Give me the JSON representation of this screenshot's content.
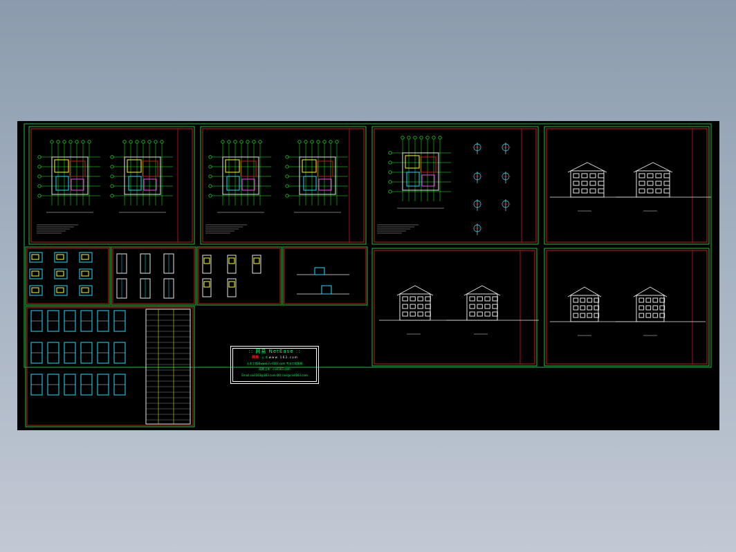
{
  "canvas": {
    "background": "#000000",
    "colors": {
      "frame_green": "#1fbf3f",
      "border_red": "#d01818",
      "line_white": "#e8e8e8",
      "axis_green": "#22ff22",
      "accent_cyan": "#20e0ff",
      "accent_yellow": "#ffff20",
      "accent_magenta": "#ff40ff"
    }
  },
  "stamp": {
    "line1": "::  网易  NetEase  ::",
    "brand": "网易",
    "brand_sub": "· 土 木",
    "brand_tail": "w w w . 1 6 3 . c o m",
    "line3": "土木工程网www.civil163.com 专业工程图纸",
    "line4": "网易土木：civil163.com",
    "line5": "Email:civil163@163.com  QQ:civil@civil163.com"
  },
  "drawing_sheets": [
    "floor-plans-1",
    "floor-plans-2",
    "floor-plans-3",
    "elevations-1",
    "details-1",
    "details-2",
    "details-3",
    "details-4",
    "elevations-2",
    "sections-1",
    "schedule-sheet"
  ]
}
